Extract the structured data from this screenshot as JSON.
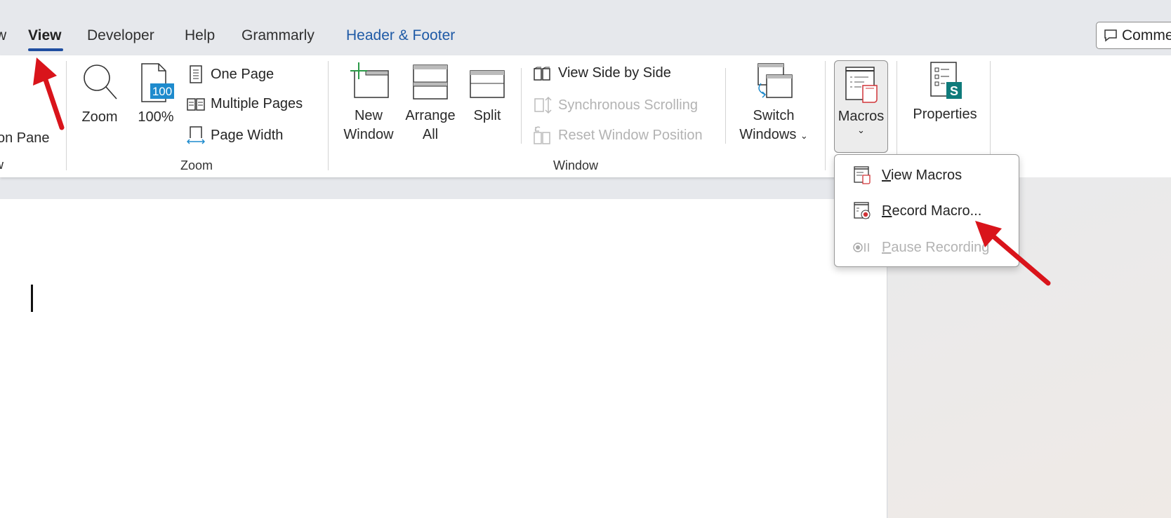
{
  "tabs": [
    {
      "label": "w"
    },
    {
      "label": "View",
      "active": true
    },
    {
      "label": "Developer"
    },
    {
      "label": "Help"
    },
    {
      "label": "Grammarly"
    },
    {
      "label": "Header & Footer",
      "contextual": true
    }
  ],
  "comments_button": {
    "label": "Comme",
    "icon": "comment-icon"
  },
  "ribbon": {
    "left_partial": {
      "item": "on Pane",
      "group": "w"
    },
    "zoom_group": {
      "label": "Zoom",
      "zoom": "Zoom",
      "hundred": "100%",
      "hundred_badge": "100",
      "one_page": "One Page",
      "multiple_pages": "Multiple Pages",
      "page_width": "Page Width"
    },
    "window_group": {
      "label": "Window",
      "new_window": [
        "New",
        "Window"
      ],
      "arrange_all": [
        "Arrange",
        "All"
      ],
      "split": "Split",
      "view_side_by_side": "View Side by Side",
      "sync_scrolling": "Synchronous Scrolling",
      "reset_window": "Reset Window Position",
      "switch_windows": [
        "Switch",
        "Windows"
      ]
    },
    "macros": {
      "label": "Macros",
      "expanded": true
    },
    "properties": {
      "label": "Properties",
      "badge": "S"
    }
  },
  "macros_menu": [
    {
      "first": "V",
      "rest": "iew Macros",
      "enabled": true,
      "icon": "view-macros-icon"
    },
    {
      "first": "R",
      "rest": "ecord Macro...",
      "enabled": true,
      "icon": "record-macro-icon"
    },
    {
      "first": "P",
      "rest": "ause Recording",
      "enabled": false,
      "icon": "pause-recording-icon"
    }
  ],
  "colors": {
    "accent": "#1f4ea0",
    "contextual_tab": "#1f5aa6",
    "annotation_arrow": "#d9141b",
    "macro_red": "#d13438",
    "sharepoint": "#0f7b7b"
  }
}
